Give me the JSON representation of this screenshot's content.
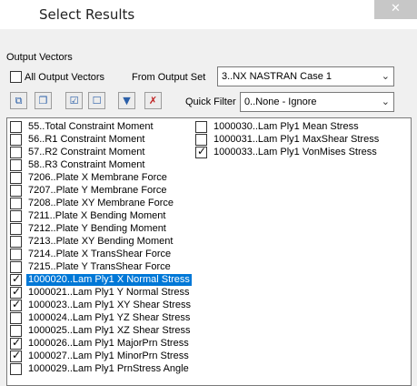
{
  "window": {
    "title": "Select Results"
  },
  "output_vectors": {
    "group_label": "Output Vectors",
    "all_output_vectors": {
      "label": "All Output Vectors",
      "checked": false
    },
    "from_output_set_label": "From Output Set",
    "output_set_value": "3..NX NASTRAN Case 1",
    "quick_filter_label": "Quick Filter",
    "quick_filter_value": "0..None - Ignore"
  },
  "toolbar": {
    "icons": [
      "select-all-icon",
      "deselect-all-icon",
      "check-selected-icon",
      "uncheck-selected-icon",
      "filter-icon",
      "clear-filter-icon"
    ]
  },
  "vectors_col1": [
    {
      "label": "55..Total Constraint Moment",
      "checked": false,
      "selected": false
    },
    {
      "label": "56..R1 Constraint Moment",
      "checked": false,
      "selected": false
    },
    {
      "label": "57..R2 Constraint Moment",
      "checked": false,
      "selected": false
    },
    {
      "label": "58..R3 Constraint Moment",
      "checked": false,
      "selected": false
    },
    {
      "label": "7206..Plate X Membrane Force",
      "checked": false,
      "selected": false
    },
    {
      "label": "7207..Plate Y Membrane Force",
      "checked": false,
      "selected": false
    },
    {
      "label": "7208..Plate XY Membrane Force",
      "checked": false,
      "selected": false
    },
    {
      "label": "7211..Plate X Bending Moment",
      "checked": false,
      "selected": false
    },
    {
      "label": "7212..Plate Y Bending Moment",
      "checked": false,
      "selected": false
    },
    {
      "label": "7213..Plate XY Bending Moment",
      "checked": false,
      "selected": false
    },
    {
      "label": "7214..Plate X TransShear Force",
      "checked": false,
      "selected": false
    },
    {
      "label": "7215..Plate Y TransShear Force",
      "checked": false,
      "selected": false
    },
    {
      "label": "1000020..Lam Ply1 X Normal Stress",
      "checked": true,
      "selected": true
    },
    {
      "label": "1000021..Lam Ply1 Y Normal Stress",
      "checked": true,
      "selected": false
    },
    {
      "label": "1000023..Lam Ply1 XY Shear Stress",
      "checked": true,
      "selected": false
    },
    {
      "label": "1000024..Lam Ply1 YZ Shear Stress",
      "checked": false,
      "selected": false
    },
    {
      "label": "1000025..Lam Ply1 XZ Shear Stress",
      "checked": false,
      "selected": false
    },
    {
      "label": "1000026..Lam Ply1 MajorPrn Stress",
      "checked": true,
      "selected": false
    },
    {
      "label": "1000027..Lam Ply1 MinorPrn Stress",
      "checked": true,
      "selected": false
    },
    {
      "label": "1000029..Lam Ply1 PrnStress Angle",
      "checked": false,
      "selected": false
    }
  ],
  "vectors_col2": [
    {
      "label": "1000030..Lam Ply1 Mean Stress",
      "checked": false,
      "selected": false
    },
    {
      "label": "1000031..Lam Ply1 MaxShear Stress",
      "checked": false,
      "selected": false
    },
    {
      "label": "1000033..Lam Ply1 VonMises Stress",
      "checked": true,
      "selected": false
    }
  ]
}
